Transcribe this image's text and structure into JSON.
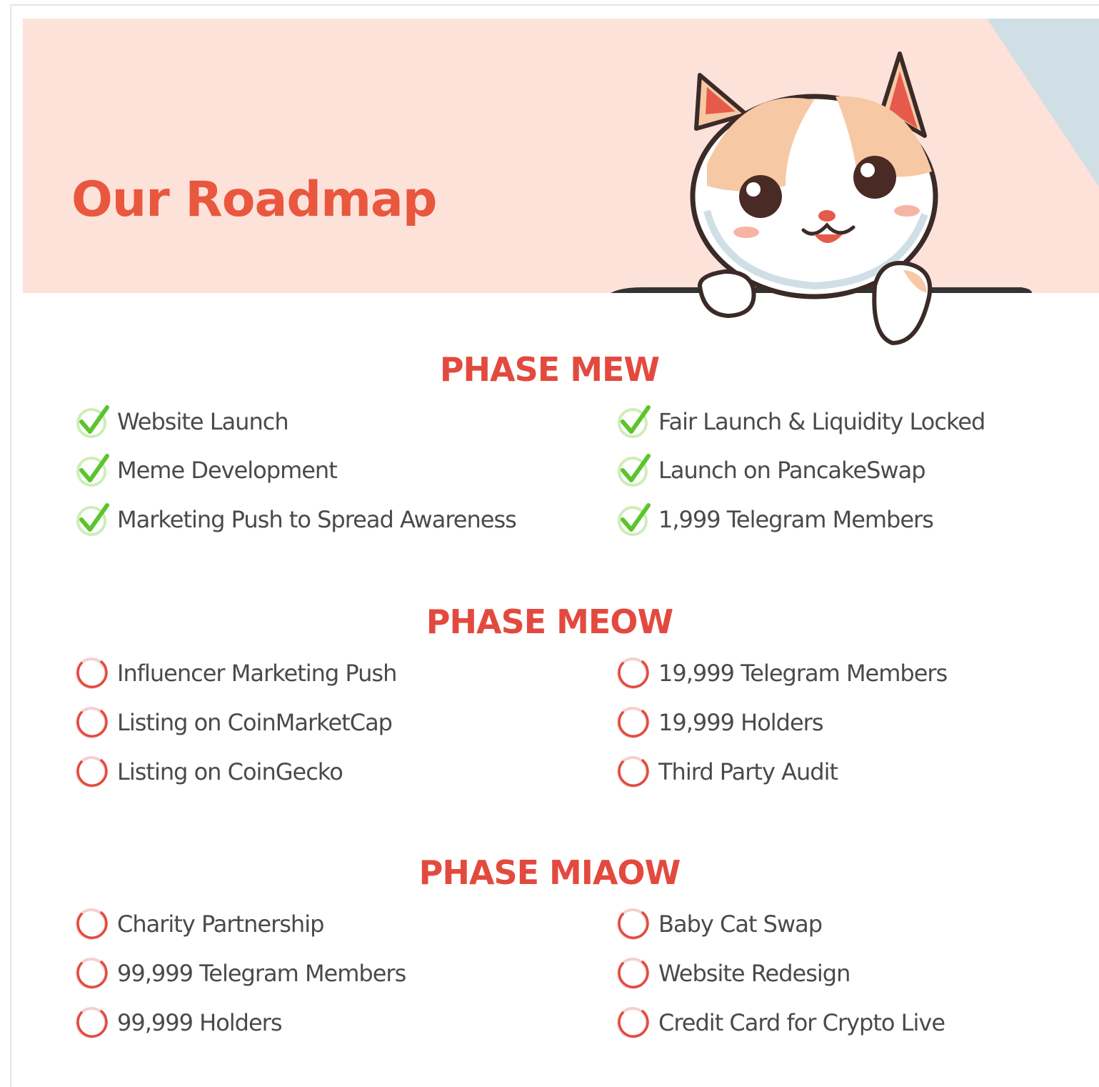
{
  "header": {
    "title": "Our Roadmap"
  },
  "colors": {
    "accent": "#e9573f",
    "check": "#6cc93b",
    "pending": "#e34a3f",
    "banner": "#fde2da"
  },
  "phases": [
    {
      "title": "PHASE MEW",
      "items": [
        {
          "label": "Website Launch",
          "status": "done"
        },
        {
          "label": "Fair Launch & Liquidity Locked",
          "status": "done"
        },
        {
          "label": "Meme Development",
          "status": "done"
        },
        {
          "label": "Launch on PancakeSwap",
          "status": "done"
        },
        {
          "label": "Marketing Push to Spread Awareness",
          "status": "done"
        },
        {
          "label": "1,999 Telegram Members",
          "status": "done"
        }
      ]
    },
    {
      "title": "PHASE MEOW",
      "items": [
        {
          "label": "Influencer Marketing Push",
          "status": "pending"
        },
        {
          "label": "19,999 Telegram Members",
          "status": "pending"
        },
        {
          "label": "Listing on CoinMarketCap",
          "status": "pending"
        },
        {
          "label": "19,999 Holders",
          "status": "pending"
        },
        {
          "label": "Listing on CoinGecko",
          "status": "pending"
        },
        {
          "label": "Third Party Audit",
          "status": "pending"
        }
      ]
    },
    {
      "title": "PHASE MIAOW",
      "items": [
        {
          "label": "Charity Partnership",
          "status": "pending"
        },
        {
          "label": "Baby Cat Swap",
          "status": "pending"
        },
        {
          "label": "99,999 Telegram Members",
          "status": "pending"
        },
        {
          "label": "Website Redesign",
          "status": "pending"
        },
        {
          "label": "99,999 Holders",
          "status": "pending"
        },
        {
          "label": "Credit Card for Crypto Live",
          "status": "pending"
        }
      ]
    }
  ]
}
